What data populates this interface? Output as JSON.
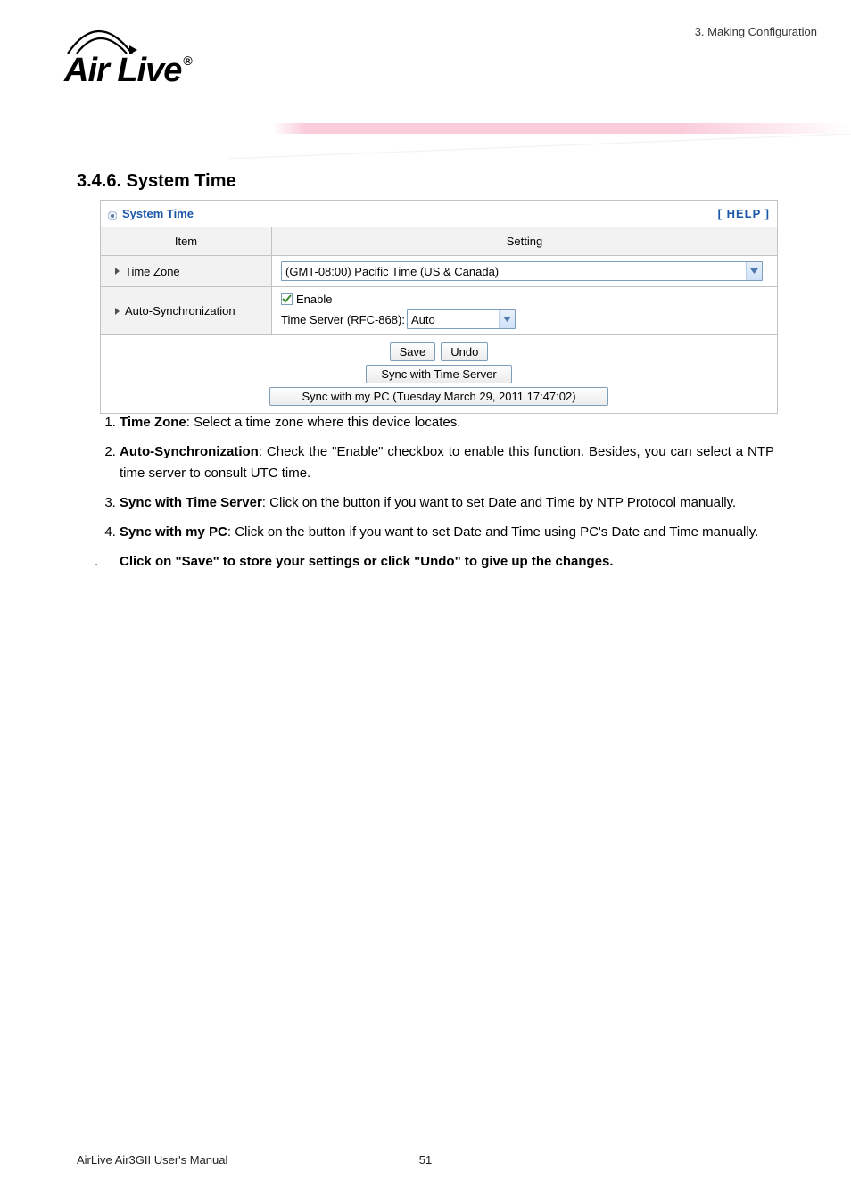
{
  "breadcrumb": "3. Making Configuration",
  "logo_text": "Air Live",
  "heading": "3.4.6.  System Time",
  "panel": {
    "title": "System Time",
    "help": "[ HELP ]",
    "header_item": "Item",
    "header_setting": "Setting",
    "row_tz_label": "Time Zone",
    "row_tz_value": "(GMT-08:00) Pacific Time (US & Canada)",
    "row_sync_label": "Auto-Synchronization",
    "row_sync_enable": "Enable",
    "row_sync_server_label": "Time Server (RFC-868):",
    "row_sync_server_value": "Auto",
    "btn_save": "Save",
    "btn_undo": "Undo",
    "btn_sync_server": "Sync with Time Server",
    "btn_sync_pc": "Sync with my PC (Tuesday March 29, 2011 17:47:02)"
  },
  "list": {
    "i1a": "Time Zone",
    "i1b": ": Select a time zone where this device locates.",
    "i2a": "Auto-Synchronization",
    "i2b": ": Check the \"Enable\" checkbox to enable this function. Besides, you can select a NTP time server to consult UTC time.",
    "i3a": "Sync with Time Server",
    "i3b": ": Click on the button if you want to set Date and Time by NTP Protocol manually.",
    "i4a": "Sync with my PC",
    "i4b": ": Click on the button if you want to set Date and Time using PC's Date and Time manually."
  },
  "final": "Click on \"Save\" to store your settings or click \"Undo\" to give up the changes.",
  "footer_left": "AirLive Air3GII User's Manual",
  "footer_page": "51"
}
